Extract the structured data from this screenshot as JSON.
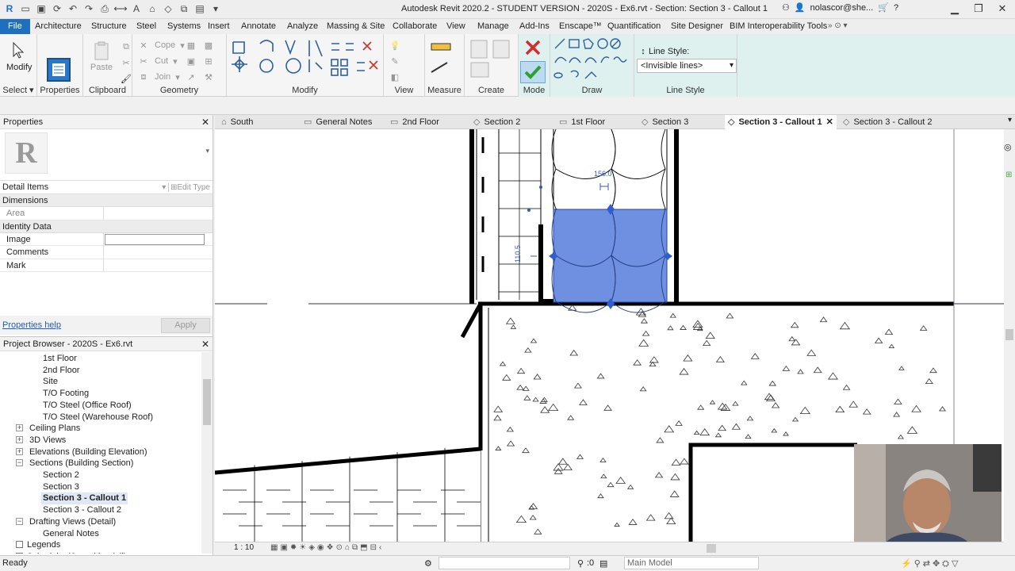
{
  "window": {
    "title": "Autodesk Revit 2020.2 - STUDENT VERSION - 2020S - Ex6.rvt - Section: Section 3 - Callout 1",
    "user": "nolascor@she..."
  },
  "ribbon_tabs": [
    "File",
    "Architecture",
    "Structure",
    "Steel",
    "Systems",
    "Insert",
    "Annotate",
    "Analyze",
    "Massing & Site",
    "Collaborate",
    "View",
    "Manage",
    "Add-Ins",
    "Enscape™",
    "Modify",
    "Quantification",
    "Site Designer",
    "BIM Interoperability Tools"
  ],
  "ribbon": {
    "modify_label": "Modify",
    "paste_label": "Paste",
    "cope_label": "Cope",
    "cut_label": "Cut",
    "join_label": "Join",
    "panels": {
      "select": "Select",
      "properties": "Properties",
      "clipboard": "Clipboard",
      "geometry": "Geometry",
      "modify": "Modify",
      "view": "View",
      "measure": "Measure",
      "create": "Create",
      "mode": "Mode",
      "draw": "Draw",
      "line_style": "Line Style"
    },
    "line_style_title": "Line Style:",
    "line_style_value": "<Invisible lines>"
  },
  "properties": {
    "title": "Properties",
    "type_filter": "Detail Items",
    "edit_type": "Edit Type",
    "groups": [
      {
        "name": "Dimensions",
        "rows": [
          {
            "key": "Area",
            "value": ""
          }
        ]
      },
      {
        "name": "Identity Data",
        "rows": [
          {
            "key": "Image",
            "value": ""
          },
          {
            "key": "Comments",
            "value": ""
          },
          {
            "key": "Mark",
            "value": ""
          }
        ]
      }
    ],
    "help_link": "Properties help",
    "apply": "Apply"
  },
  "browser": {
    "title": "Project Browser - 2020S - Ex6.rvt",
    "items": [
      {
        "label": "1st Floor",
        "level": 2
      },
      {
        "label": "2nd Floor",
        "level": 2
      },
      {
        "label": "Site",
        "level": 2
      },
      {
        "label": "T/O Footing",
        "level": 2
      },
      {
        "label": "T/O Steel (Office Roof)",
        "level": 2
      },
      {
        "label": "T/O Steel (Warehouse Roof)",
        "level": 2
      },
      {
        "label": "Ceiling Plans",
        "level": 1,
        "toggle": "+"
      },
      {
        "label": "3D Views",
        "level": 1,
        "toggle": "+"
      },
      {
        "label": "Elevations (Building Elevation)",
        "level": 1,
        "toggle": "+"
      },
      {
        "label": "Sections (Building Section)",
        "level": 1,
        "toggle": "−"
      },
      {
        "label": "Section 2",
        "level": 2
      },
      {
        "label": "Section 3",
        "level": 2
      },
      {
        "label": "Section 3 - Callout 1",
        "level": 2,
        "selected": true
      },
      {
        "label": "Section 3 - Callout 2",
        "level": 2
      },
      {
        "label": "Drafting Views (Detail)",
        "level": 1,
        "toggle": "−"
      },
      {
        "label": "General  Notes",
        "level": 2
      },
      {
        "label": "Legends",
        "level": 0
      },
      {
        "label": "Schedules/Quantities (all)",
        "level": 0
      }
    ]
  },
  "view_tabs": [
    {
      "label": "South"
    },
    {
      "label": "General  Notes"
    },
    {
      "label": "2nd Floor"
    },
    {
      "label": "Section 2"
    },
    {
      "label": "1st Floor"
    },
    {
      "label": "Section 3"
    },
    {
      "label": "Section 3 - Callout 1",
      "active": true
    },
    {
      "label": "Section 3 - Callout 2"
    }
  ],
  "canvas": {
    "dimensions": [
      "156.0",
      "110.5"
    ],
    "selection_color": "#6f8fe0"
  },
  "view_control": {
    "scale": "1 : 10"
  },
  "status": {
    "text": "Ready",
    "zero": ":0",
    "model": "Main Model"
  },
  "colors": {
    "file_tab": "#1f6fbf",
    "context_tab": "#d9f0f0",
    "accent_link": "#1f5fbf"
  }
}
